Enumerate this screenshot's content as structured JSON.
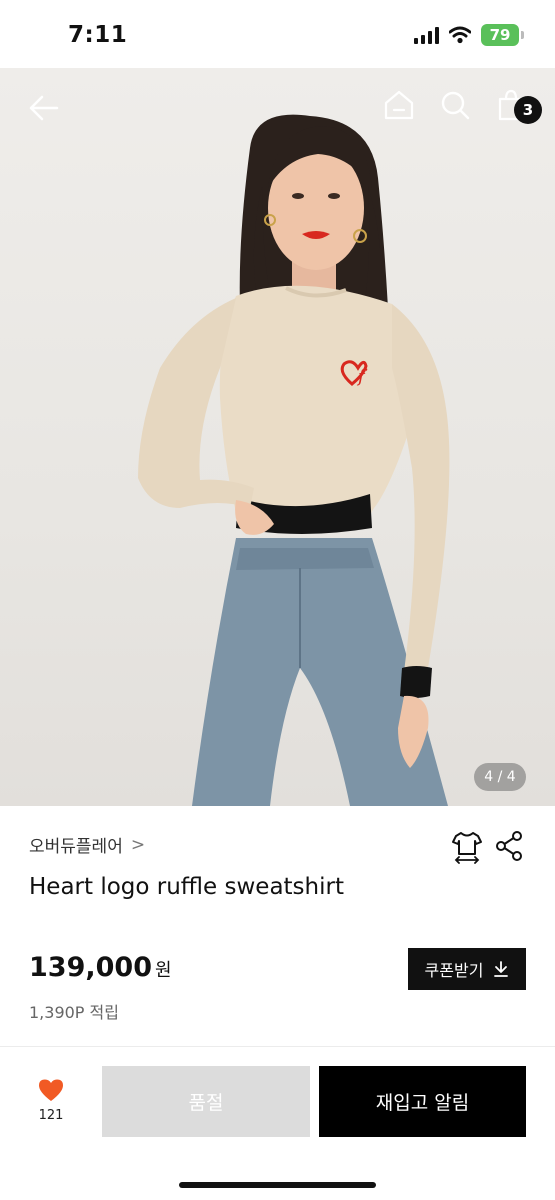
{
  "status_bar": {
    "time": "7:11",
    "battery": "79"
  },
  "header": {
    "cart_count": "3",
    "icons": [
      "back-arrow-icon",
      "home-icon",
      "search-icon",
      "shopping-bag-icon"
    ]
  },
  "gallery": {
    "indicator": "4 / 4",
    "current": 4,
    "total": 4,
    "image": "model wearing beige cropped sweatshirt with red heart logo and light denim jeans"
  },
  "product": {
    "brand": "오버듀플레어",
    "brand_chevron": ">",
    "title": "Heart logo ruffle sweatshirt",
    "price": "139,000",
    "price_unit": "원",
    "points": "1,390P 적립",
    "coupon_label": "쿠폰받기"
  },
  "actions": {
    "like_count": "121",
    "soldout_label": "품절",
    "restock_label": "재입고 알림"
  },
  "colors": {
    "accent_heart": "#f15a24",
    "primary_button": "#000000",
    "disabled_button": "#dcdcdc",
    "battery": "#5ac05a"
  }
}
